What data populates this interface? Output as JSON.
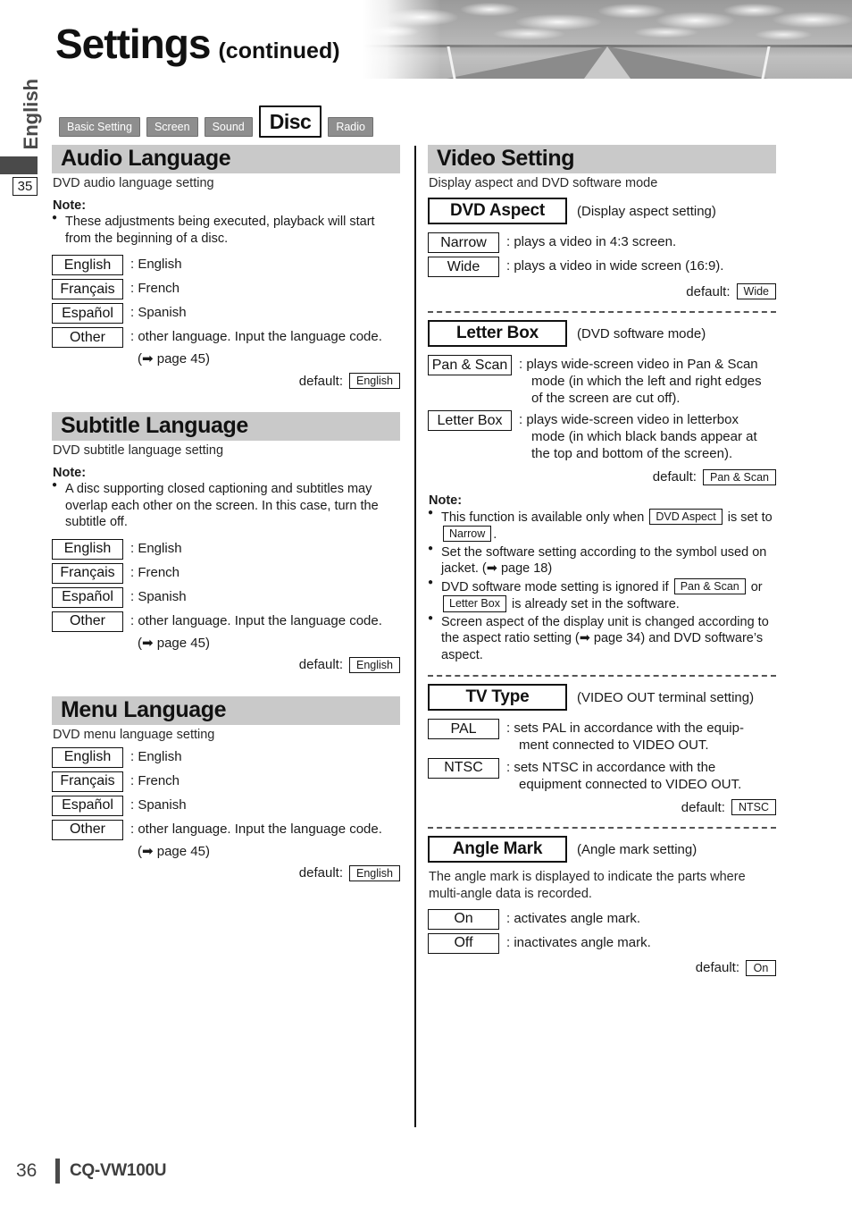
{
  "header": {
    "title_main": "Settings",
    "title_sub": "(continued)",
    "rail_language": "English",
    "rail_page_marker": "35"
  },
  "tabs": [
    {
      "label": "Basic Setting",
      "active": false
    },
    {
      "label": "Screen",
      "active": false
    },
    {
      "label": "Sound",
      "active": false
    },
    {
      "label": "Disc",
      "active": true
    },
    {
      "label": "Radio",
      "active": false
    }
  ],
  "labels": {
    "note_title": "Note:",
    "default_label": "default:",
    "colon": ":"
  },
  "left_column": {
    "audio_language": {
      "heading": "Audio Language",
      "description": "DVD audio language setting",
      "note_title": "Note:",
      "notes": [
        "These adjustments being executed, playback will start from the beginning of a disc."
      ],
      "options": [
        {
          "box": "English",
          "desc": ": English"
        },
        {
          "box": "Français",
          "desc": ": French"
        },
        {
          "box": "Español",
          "desc": ": Spanish"
        },
        {
          "box": "Other",
          "desc": ": other language. Input the language code."
        }
      ],
      "continuation": "(➡ page 45)",
      "default_value": "English"
    },
    "subtitle_language": {
      "heading": "Subtitle Language",
      "description": "DVD subtitle language setting",
      "note_title": "Note:",
      "notes": [
        "A disc supporting closed captioning and subtitles may overlap each other on the screen. In this case, turn the subtitle off."
      ],
      "options": [
        {
          "box": "English",
          "desc": ": English"
        },
        {
          "box": "Français",
          "desc": ": French"
        },
        {
          "box": "Español",
          "desc": ": Spanish"
        },
        {
          "box": "Other",
          "desc": ": other language. Input the language code."
        }
      ],
      "continuation": "(➡ page 45)",
      "default_value": "English"
    },
    "menu_language": {
      "heading": "Menu Language",
      "description": "DVD menu language setting",
      "options": [
        {
          "box": "English",
          "desc": ": English"
        },
        {
          "box": "Français",
          "desc": ": French"
        },
        {
          "box": "Español",
          "desc": ": Spanish"
        },
        {
          "box": "Other",
          "desc": ": other language. Input the language code."
        }
      ],
      "continuation": "(➡ page 45)",
      "default_value": "English"
    }
  },
  "right_column": {
    "video_setting": {
      "heading": "Video Setting",
      "description": "Display aspect and DVD software mode"
    },
    "dvd_aspect": {
      "button": "DVD Aspect",
      "caption": "(Display aspect setting)",
      "options": [
        {
          "box": "Narrow",
          "desc": ": plays a video in 4:3 screen."
        },
        {
          "box": "Wide",
          "desc": ": plays a video in wide screen (16:9)."
        }
      ],
      "default_value": "Wide"
    },
    "letter_box": {
      "button": "Letter Box",
      "caption": "(DVD software mode)",
      "options": [
        {
          "box": "Pan & Scan",
          "desc": ": plays wide-screen video in Pan & Scan",
          "desc2": "mode (in which the left and right edges",
          "desc3": "of the screen are cut off)."
        },
        {
          "box": "Letter Box",
          "desc": ": plays wide-screen video in letterbox",
          "desc2": "mode (in which black bands appear at",
          "desc3": "the top and bottom of the screen)."
        }
      ],
      "default_value": "Pan & Scan"
    },
    "notes": {
      "title": "Note:",
      "items": [
        {
          "parts": [
            {
              "t": "text",
              "v": "This function is available only when "
            },
            {
              "t": "chip",
              "v": "DVD Aspect"
            },
            {
              "t": "text",
              "v": " is set to "
            },
            {
              "t": "chip",
              "v": "Narrow"
            },
            {
              "t": "text",
              "v": "."
            }
          ]
        },
        {
          "parts": [
            {
              "t": "text",
              "v": "Set the software setting according to the symbol used on jacket. (➡ page 18)"
            }
          ]
        },
        {
          "parts": [
            {
              "t": "text",
              "v": "DVD software mode setting is ignored if "
            },
            {
              "t": "chip",
              "v": "Pan & Scan"
            },
            {
              "t": "text",
              "v": " or "
            },
            {
              "t": "chip",
              "v": "Letter Box"
            },
            {
              "t": "text",
              "v": " is already set in the software."
            }
          ]
        },
        {
          "parts": [
            {
              "t": "text",
              "v": "Screen aspect of the display unit is changed according to the aspect ratio setting (➡ page 34) and DVD software’s aspect."
            }
          ]
        }
      ]
    },
    "tv_type": {
      "button": "TV Type",
      "caption": "(VIDEO OUT terminal setting)",
      "options": [
        {
          "box": "PAL",
          "desc": ": sets PAL in accordance with the equip-",
          "desc2": "ment connected to VIDEO OUT."
        },
        {
          "box": "NTSC",
          "desc": ": sets NTSC in accordance with the",
          "desc2": "equipment connected to VIDEO OUT."
        }
      ],
      "default_value": "NTSC"
    },
    "angle_mark": {
      "button": "Angle Mark",
      "caption": "(Angle mark setting)",
      "description": "The angle mark is displayed to indicate the parts where multi-angle data is recorded.",
      "options": [
        {
          "box": "On",
          "desc": ": activates angle mark."
        },
        {
          "box": "Off",
          "desc": ": inactivates angle mark."
        }
      ],
      "default_value": "On"
    }
  },
  "footer": {
    "page_number": "36",
    "model": "CQ-VW100U"
  }
}
